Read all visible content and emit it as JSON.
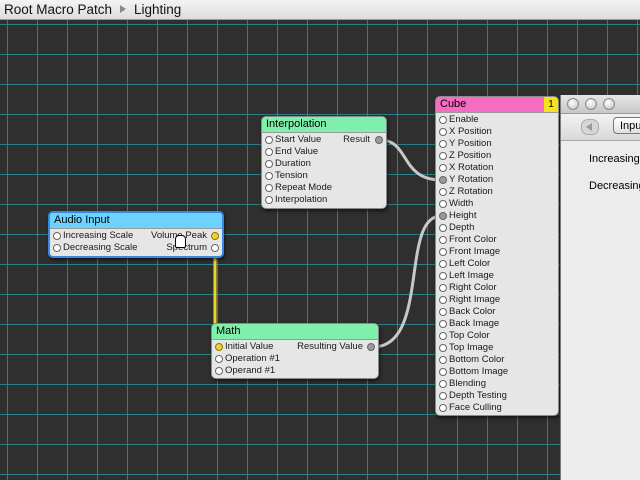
{
  "breadcrumb": {
    "root": "Root Macro Patch",
    "current": "Lighting"
  },
  "patches": {
    "interpolation": {
      "title": "Interpolation",
      "color": "#7ff0ab",
      "inputs": [
        "Start Value",
        "End Value",
        "Duration",
        "Tension",
        "Repeat Mode",
        "Interpolation"
      ],
      "outputs": [
        "Result"
      ]
    },
    "audio_input": {
      "title": "Audio Input",
      "color": "#6cd2ff",
      "inputs": [
        "Increasing Scale",
        "Decreasing Scale"
      ],
      "outputs": [
        "Volume Peak",
        "Spectrum"
      ]
    },
    "math": {
      "title": "Math",
      "color": "#7ff0ab",
      "inputs": [
        "Initial Value",
        "Operation #1",
        "Operand #1"
      ],
      "outputs": [
        "Resulting Value"
      ]
    },
    "cube": {
      "title": "Cube",
      "badge": "1",
      "color": "#f56cc0",
      "inputs": [
        "Enable",
        "X Position",
        "Y Position",
        "Z Position",
        "X Rotation",
        "Y Rotation",
        "Z Rotation",
        "Width",
        "Height",
        "Depth",
        "Front Color",
        "Front Image",
        "Left Color",
        "Left Image",
        "Right Color",
        "Right Image",
        "Back Color",
        "Back Image",
        "Top Color",
        "Top Image",
        "Bottom Color",
        "Bottom Image",
        "Blending",
        "Depth Testing",
        "Face Culling"
      ]
    }
  },
  "inspector": {
    "input_button": "Input",
    "rows": [
      "Increasing",
      "Decreasing"
    ]
  },
  "colors": {
    "canvas": "#2f2f2f",
    "grid": "#2d8c96",
    "cable_yellow": "#e8d630",
    "cable_gray": "#c8c8c8"
  }
}
